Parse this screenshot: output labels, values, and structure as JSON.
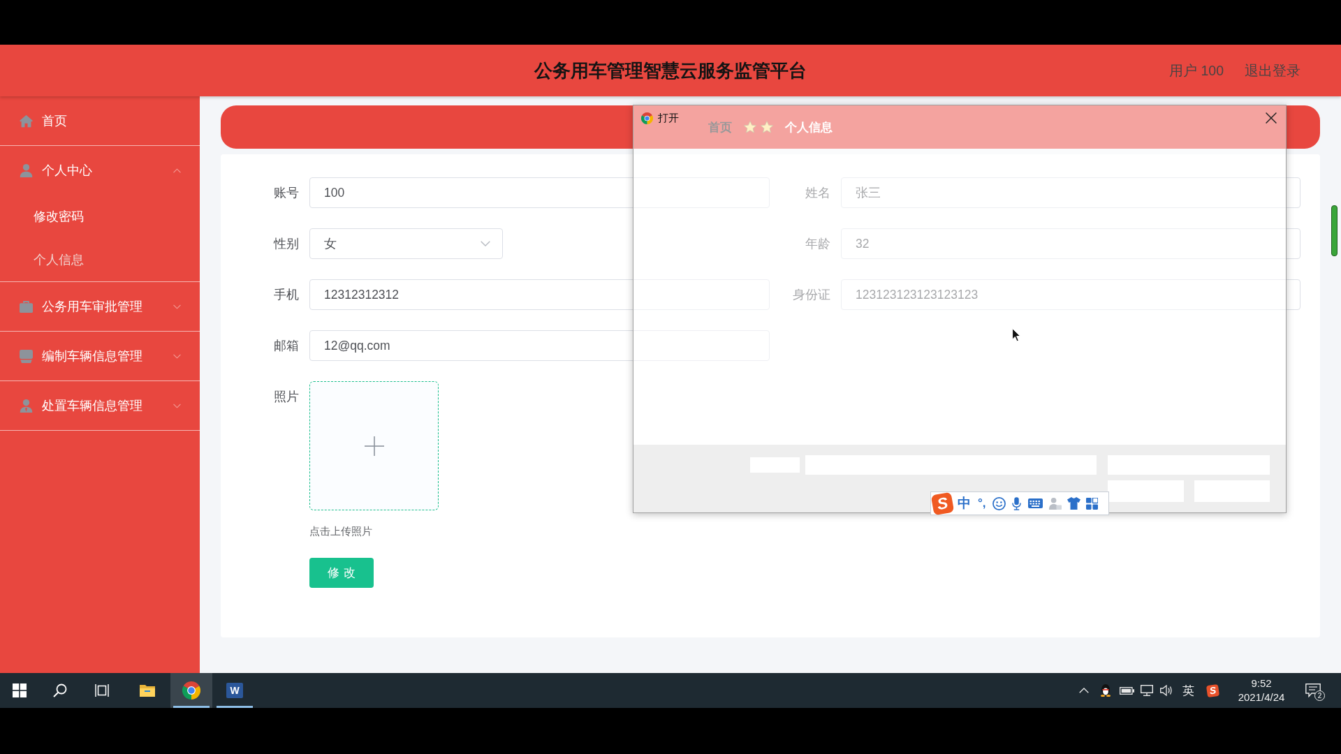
{
  "header": {
    "title": "公务用车管理智慧云服务监管平台",
    "user": "用户 100",
    "logout": "退出登录"
  },
  "sidebar": {
    "items": [
      {
        "kind": "link",
        "label": "首页",
        "selected": false
      },
      {
        "kind": "group",
        "label": "个人中心",
        "expanded": true,
        "children": [
          {
            "label": "修改密码",
            "selected": false
          },
          {
            "label": "个人信息",
            "selected": true
          }
        ]
      },
      {
        "kind": "group",
        "label": "公务用车审批管理",
        "expanded": false
      },
      {
        "kind": "group",
        "label": "编制车辆信息管理",
        "expanded": false
      },
      {
        "kind": "group",
        "label": "处置车辆信息管理",
        "expanded": false
      }
    ]
  },
  "breadcrumb": [
    {
      "label": "首页",
      "current": false
    },
    {
      "label": "个人信息",
      "current": true
    }
  ],
  "form": {
    "rows": [
      {
        "fields": [
          {
            "kind": "input",
            "label": "账号",
            "value": "100"
          },
          {
            "kind": "input",
            "label": "姓名",
            "value": "张三"
          }
        ]
      },
      {
        "fields": [
          {
            "kind": "select",
            "label": "性别",
            "value": "女"
          },
          {
            "kind": "input",
            "label": "年龄",
            "value": "32"
          }
        ]
      },
      {
        "fields": [
          {
            "kind": "input",
            "label": "手机",
            "value": "12312312312"
          },
          {
            "kind": "input",
            "label": "身份证",
            "value": "123123123123123123"
          }
        ]
      },
      {
        "fields": [
          {
            "kind": "input",
            "label": "邮箱",
            "value": "12@qq.com"
          }
        ]
      },
      {
        "fields": [
          {
            "kind": "upload",
            "label": "照片",
            "hint": "点击上传照片"
          }
        ]
      }
    ],
    "submit": "修改"
  },
  "dialog": {
    "title": "打开"
  },
  "ime_toolbar": {
    "logo": "S",
    "mode": "中",
    "punctuation": "°,"
  },
  "taskbar": {
    "apps": [
      {
        "kind": "folder",
        "running": false,
        "active": false
      },
      {
        "kind": "browser",
        "running": true,
        "active": true
      },
      {
        "kind": "document",
        "running": true,
        "active": false,
        "letter": "W"
      }
    ],
    "tray": {
      "language": "英",
      "ime_logo": "S",
      "time": "9:52",
      "date": "2021/4/24",
      "notifications": "2"
    }
  }
}
